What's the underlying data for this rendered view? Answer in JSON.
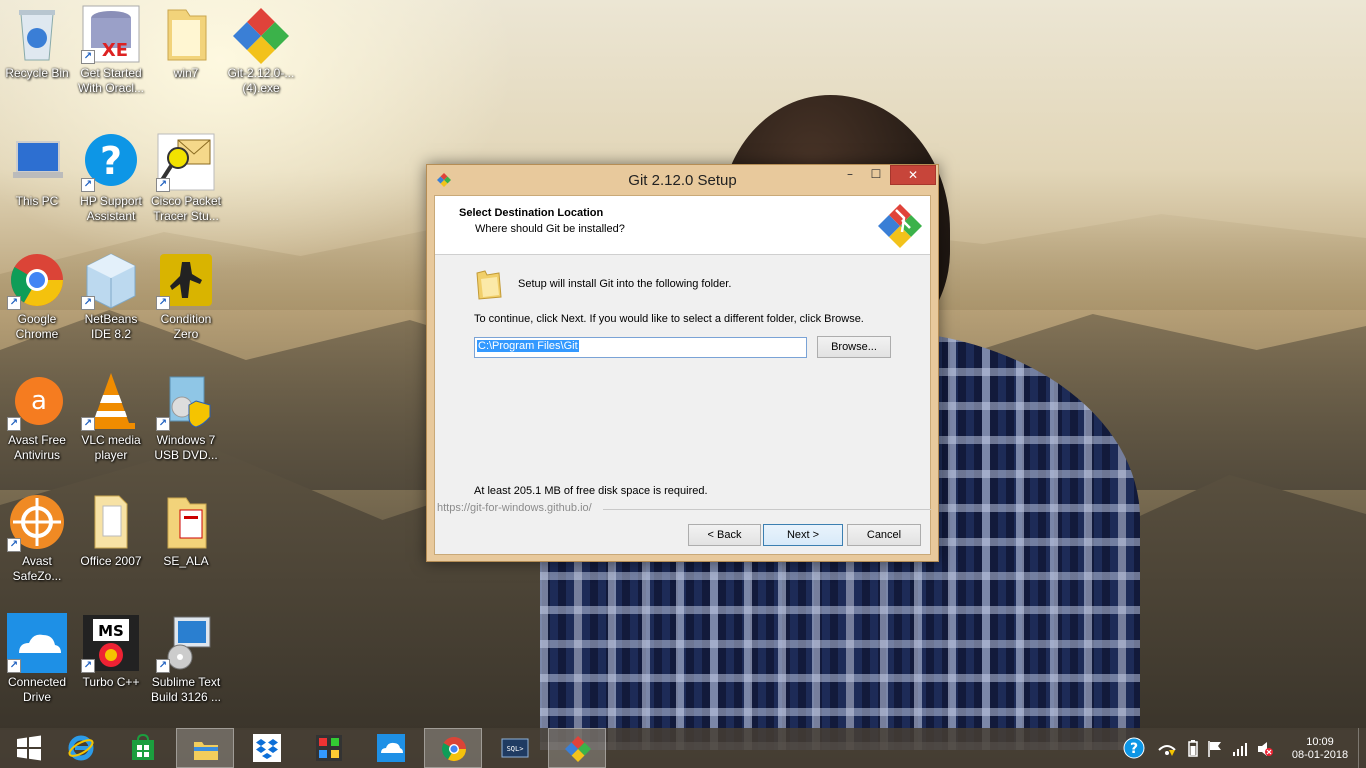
{
  "desktop": {
    "icons": [
      {
        "label": "Recycle Bin",
        "icon": "recycle-bin-icon"
      },
      {
        "label": "Get Started With Oracl...",
        "icon": "oracle-xe-icon"
      },
      {
        "label": "win7",
        "icon": "folder-icon"
      },
      {
        "label": "Git-2.12.0-... (4).exe",
        "icon": "git-installer-icon"
      },
      {
        "label": "This PC",
        "icon": "computer-icon"
      },
      {
        "label": "HP Support Assistant",
        "icon": "help-icon"
      },
      {
        "label": "Cisco Packet Tracer Stu...",
        "icon": "packet-tracer-icon"
      },
      {
        "label": "Google Chrome",
        "icon": "chrome-icon"
      },
      {
        "label": "NetBeans IDE 8.2",
        "icon": "netbeans-icon"
      },
      {
        "label": "Condition Zero",
        "icon": "counter-strike-icon"
      },
      {
        "label": "Avast Free Antivirus",
        "icon": "avast-icon"
      },
      {
        "label": "VLC media player",
        "icon": "vlc-icon"
      },
      {
        "label": "Windows 7 USB DVD...",
        "icon": "usb-dvd-tool-icon"
      },
      {
        "label": "Avast SafeZo...",
        "icon": "avast-safezone-icon"
      },
      {
        "label": "Office 2007",
        "icon": "folder-icon"
      },
      {
        "label": "SE_ALA",
        "icon": "folder-icon"
      },
      {
        "label": "Connected Drive",
        "icon": "onedrive-icon"
      },
      {
        "label": "Turbo C++",
        "icon": "turbo-cpp-icon"
      },
      {
        "label": "Sublime Text Build 3126 ...",
        "icon": "sublime-icon"
      }
    ]
  },
  "dialog": {
    "title": "Git 2.12.0 Setup",
    "heading": "Select Destination Location",
    "subheading": "Where should Git be installed?",
    "intro": "Setup will install Git into the following folder.",
    "instruction": "To continue, click Next. If you would like to select a different folder, click Browse.",
    "path_value": "C:\\Program Files\\Git",
    "browse_label": "Browse...",
    "disk_space": "At least 205.1 MB of free disk space is required.",
    "brand_url": "https://git-for-windows.github.io/",
    "back_label": "< Back",
    "next_label": "Next >",
    "cancel_label": "Cancel",
    "accent": "#c7453a"
  },
  "taskbar": {
    "items": [
      "start-icon",
      "internet-explorer-icon",
      "store-icon",
      "file-explorer-icon",
      "dropbox-icon",
      "photos-icon",
      "onedrive-icon",
      "chrome-icon",
      "sql-icon",
      "git-icon"
    ],
    "clock_time": "10:09",
    "clock_date": "08-01-2018"
  }
}
